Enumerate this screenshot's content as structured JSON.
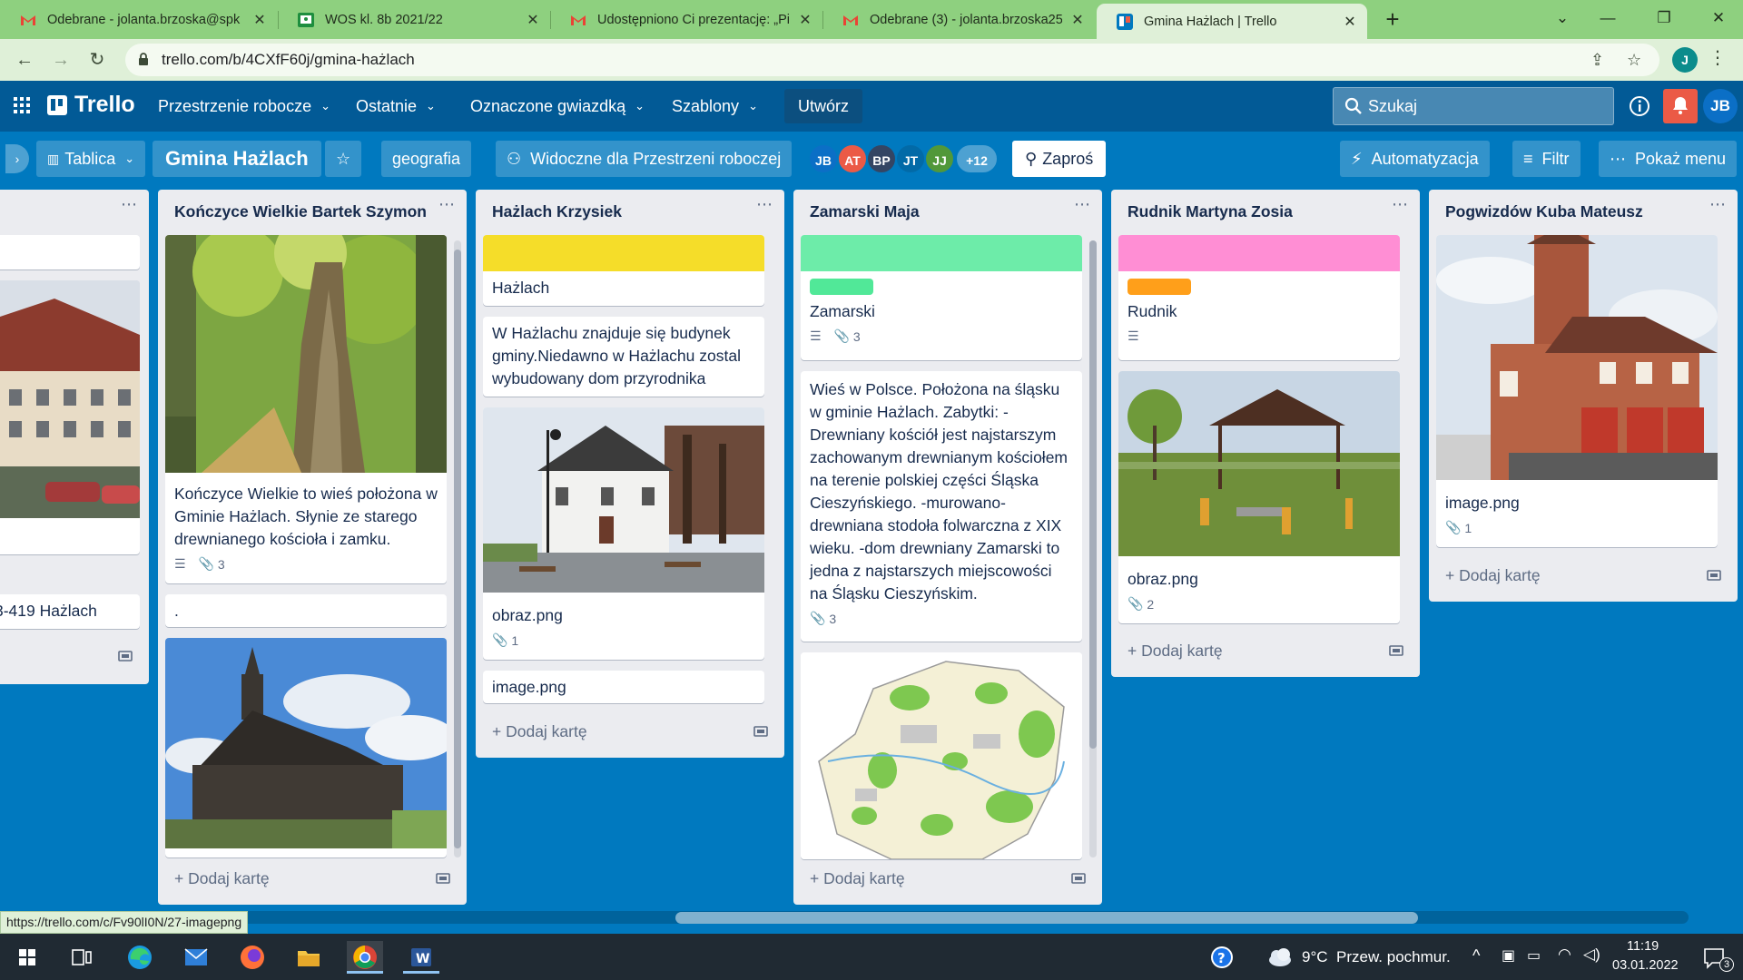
{
  "browser": {
    "tabs": [
      {
        "title": "Odebrane - jolanta.brzoska@spk",
        "icon": "gmail-icon"
      },
      {
        "title": "WOS kl. 8b 2021/22",
        "icon": "classroom-icon"
      },
      {
        "title": "Udostępniono Ci prezentację: „Pi",
        "icon": "gmail-icon"
      },
      {
        "title": "Odebrane (3) - jolanta.brzoska25",
        "icon": "gmail-icon"
      },
      {
        "title": "Gmina Hażlach | Trello",
        "icon": "trello-icon",
        "active": true
      }
    ],
    "url": "trello.com/b/4CXfF60j/gmina-hażlach",
    "profile_initial": "J"
  },
  "trello": {
    "logo": "Trello",
    "menu": [
      "Przestrzenie robocze",
      "Ostatnie",
      "Oznaczone gwiazdką",
      "Szablony"
    ],
    "create": "Utwórz",
    "search_placeholder": "Szukaj",
    "user_initials": "JB"
  },
  "board": {
    "view": "Tablica",
    "title": "Gmina Hażlach",
    "workspace": "geografia",
    "visibility": "Widoczne dla Przestrzeni roboczej",
    "members": [
      {
        "initials": "JB",
        "color": "#0b6fc6"
      },
      {
        "initials": "AT",
        "color": "#eb5a46"
      },
      {
        "initials": "BP",
        "color": "#344563"
      },
      {
        "initials": "JT",
        "color": "#026aa7"
      },
      {
        "initials": "JJ",
        "color": "#519839"
      }
    ],
    "more_members": "+12",
    "invite": "Zaproś",
    "automation": "Automatyzacja",
    "filter": "Filtr",
    "show_menu": "Pokaż menu"
  },
  "lists": {
    "partial": {
      "address": "3-419 Hażlach"
    },
    "konczyce": {
      "title": "Kończyce Wielkie Bartek Szymon",
      "card1_text": "Kończyce Wielkie to wieś położona w Gminie Hażlach. Słynie ze starego drewnianego kościoła i zamku.",
      "card1_attachments": "3",
      "card2_text": ".",
      "card3_text": ".",
      "add_card": "Dodaj kartę"
    },
    "hazlach": {
      "title": "Hażlach Krzysiek",
      "label_color": "#f5dd29",
      "card1_text": "Hażlach",
      "card2_text": "W Hażlachu znajduje się budynek gminy.Niedawno w Hażlachu zostal wybudowany dom przyrodnika",
      "card3_text": "obraz.png",
      "card3_attachments": "1",
      "card4_text": "image.png",
      "add_card": "Dodaj kartę"
    },
    "zamarski": {
      "title": "Zamarski Maja",
      "label_color": "#6deca9",
      "chip_color": "#51e898",
      "card1_text": "Zamarski",
      "card1_attachments": "3",
      "card2_text": "Wieś w Polsce. Położona na śląsku w gminie Hażlach. Zabytki: -Drewniany kościół jest najstarszym zachowanym drewnianym kościołem na terenie polskiej części Śląska Cieszyńskiego. -murowano-drewniana stodoła folwarczna z XIX wieku. -dom drewniany Zamarski to jedna z najstarszych miejscowości na Śląsku Cieszyńskim.",
      "card2_attachments": "3",
      "add_card": "Dodaj kartę"
    },
    "rudnik": {
      "title": "Rudnik Martyna Zosia",
      "label_color": "#ff8ed4",
      "chip_color": "#ff9f1a",
      "card1_text": "Rudnik",
      "card2_text": "obraz.png",
      "card2_attachments": "2",
      "add_card": "Dodaj kartę"
    },
    "pogwizdow": {
      "title": "Pogwizdów Kuba Mateusz",
      "card1_text": "image.png",
      "card1_attachments": "1",
      "add_card": "Dodaj kartę"
    }
  },
  "status_link": "https://trello.com/c/Fv90lI0N/27-imagepng",
  "taskbar": {
    "temperature": "9°C",
    "weather": "Przew. pochmur.",
    "time": "11:19",
    "date": "03.01.2022",
    "notifications": "3"
  }
}
